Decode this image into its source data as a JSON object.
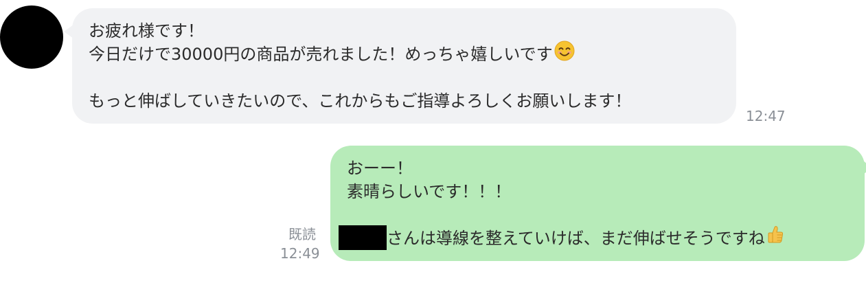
{
  "incoming_message": {
    "lines": [
      "お疲れ様です！",
      "今日だけで30000円の商品が売れました！めっちゃ嬉しいです",
      "",
      "もっと伸ばしていきたいので、これからもご指導よろしくお願いします！"
    ],
    "emoji_icon": "smiling-face-emoji",
    "time": "12:47",
    "bubble_color": "#f1f2f4"
  },
  "outgoing_message": {
    "lines": [
      "おーー！",
      "素晴らしいです！！！",
      "",
      "さんは導線を整えていけば、まだ伸ばせそうですね"
    ],
    "emoji_icon": "thumbs-up-emoji",
    "read_label": "既読",
    "time": "12:49",
    "bubble_color": "#b7ebb9"
  }
}
